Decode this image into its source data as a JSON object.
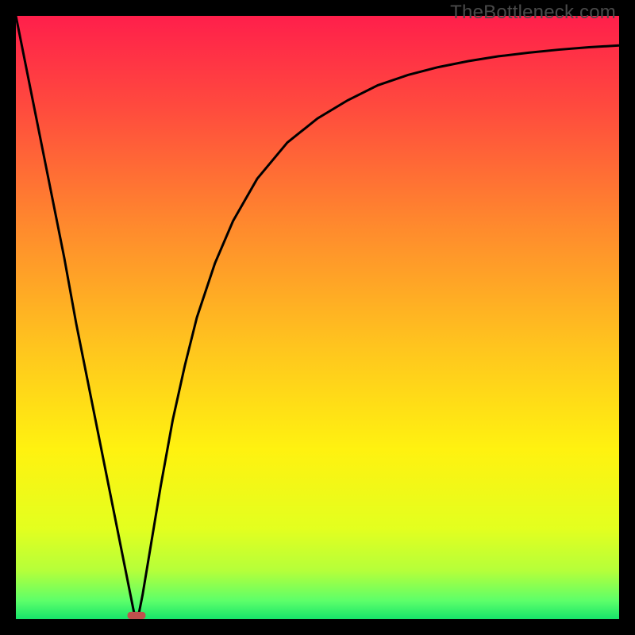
{
  "watermark": "TheBottleneck.com",
  "chart_data": {
    "type": "line",
    "title": "",
    "xlabel": "",
    "ylabel": "",
    "xlim": [
      0,
      100
    ],
    "ylim": [
      0,
      100
    ],
    "grid": false,
    "legend": false,
    "background_gradient": {
      "stops": [
        {
          "offset": 0.0,
          "color": "#ff1f4b"
        },
        {
          "offset": 0.15,
          "color": "#ff4a3e"
        },
        {
          "offset": 0.35,
          "color": "#ff8a2d"
        },
        {
          "offset": 0.55,
          "color": "#ffc51e"
        },
        {
          "offset": 0.72,
          "color": "#fff210"
        },
        {
          "offset": 0.85,
          "color": "#e3ff1f"
        },
        {
          "offset": 0.92,
          "color": "#b5ff3a"
        },
        {
          "offset": 0.97,
          "color": "#5cff6a"
        },
        {
          "offset": 1.0,
          "color": "#16e46a"
        }
      ]
    },
    "series": [
      {
        "name": "bottleneck-curve",
        "color": "#000000",
        "x": [
          0,
          2,
          4,
          6,
          8,
          10,
          12,
          14,
          16,
          17,
          18,
          19,
          19.6,
          20.4,
          21,
          22,
          23,
          24,
          26,
          28,
          30,
          33,
          36,
          40,
          45,
          50,
          55,
          60,
          65,
          70,
          75,
          80,
          85,
          90,
          95,
          100
        ],
        "y": [
          100,
          90,
          80,
          70,
          60,
          49,
          39,
          29,
          19,
          14,
          9,
          4,
          1,
          1,
          4,
          10,
          16,
          22,
          33,
          42,
          50,
          59,
          66,
          73,
          79,
          83,
          86,
          88.5,
          90.2,
          91.5,
          92.5,
          93.3,
          93.9,
          94.4,
          94.8,
          95.1
        ]
      }
    ],
    "marker": {
      "name": "optimal-point",
      "x": 20,
      "y": 0,
      "width_pct": 3.0,
      "height_pct": 1.2,
      "color": "#c0504d"
    }
  }
}
